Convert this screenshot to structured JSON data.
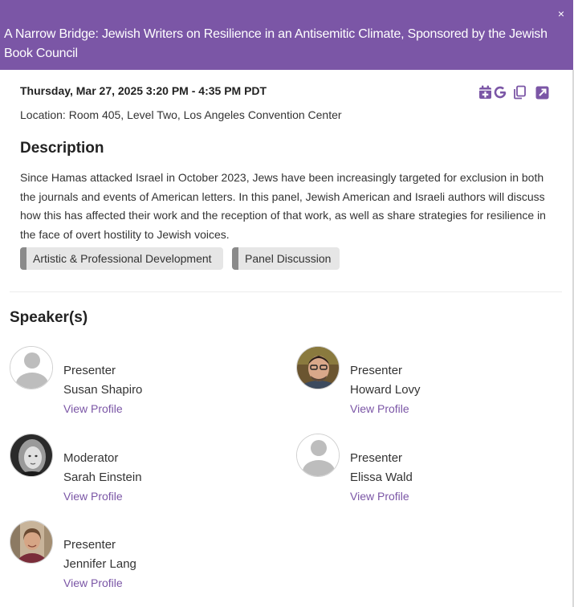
{
  "session": {
    "title": "A Narrow Bridge: Jewish Writers on Resilience in an Antisemitic Climate, Sponsored by the Jewish Book Council",
    "close_label": "×",
    "datetime": "Thursday, Mar 27, 2025 3:20 PM - 4:35 PM PDT",
    "location": "Location: Room 405, Level Two, Los Angeles Convention Center",
    "description_heading": "Description",
    "description": "Since Hamas attacked Israel in October 2023, Jews have been increasingly targeted for exclusion in both the journals and events of American letters. In this panel, Jewish American and Israeli authors will discuss how this has affected their work and the reception of that work, as well as share strategies for resilience in the face of overt hostility to Jewish voices.",
    "tags": [
      "Artistic & Professional Development",
      "Panel Discussion"
    ]
  },
  "actions": {
    "icons": [
      "calendar-add-icon",
      "google-calendar-icon",
      "copy-icon",
      "external-link-icon"
    ],
    "google_label": "G"
  },
  "speakers_heading": "Speaker(s)",
  "speakers": [
    {
      "role": "Presenter",
      "name": "Susan Shapiro",
      "link": "View Profile",
      "avatar": "default"
    },
    {
      "role": "Presenter",
      "name": "Howard Lovy",
      "link": "View Profile",
      "avatar": "photo"
    },
    {
      "role": "Moderator",
      "name": "Sarah Einstein",
      "link": "View Profile",
      "avatar": "photo"
    },
    {
      "role": "Presenter",
      "name": "Elissa Wald",
      "link": "View Profile",
      "avatar": "default"
    },
    {
      "role": "Presenter",
      "name": "Jennifer Lang",
      "link": "View Profile",
      "avatar": "photo"
    }
  ],
  "colors": {
    "header_bg": "#7b56a6",
    "link": "#7b56a6",
    "tag_bg": "#e6e6e6",
    "tag_accent": "#8a8a8a"
  }
}
